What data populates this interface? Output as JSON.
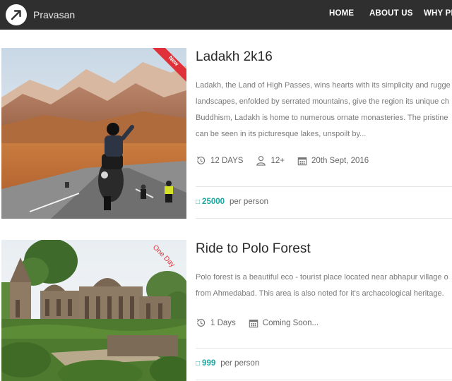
{
  "brand": {
    "name": "Pravasan"
  },
  "nav": {
    "items": [
      "HOME",
      "ABOUT US",
      "WHY PR"
    ]
  },
  "colors": {
    "navbar": "#2f2f2f",
    "accent": "#1aa7a1",
    "ribbon": "#e0303a"
  },
  "cards": [
    {
      "title": "Ladakh 2k16",
      "ribbon": "New",
      "description": [
        "Ladakh, the Land of High Passes, wins hearts with its simplicity and rugge",
        "landscapes, enfolded by serrated mountains, give the region its unique ch",
        "Buddhism, Ladakh is home to numerous ornate monasteries. The pristine",
        "can be seen in its picturesque lakes, unspoilt by..."
      ],
      "duration": "12 DAYS",
      "age": "12+",
      "date": "20th Sept, 2016",
      "currency_icon": "rupee-icon",
      "price": "25000",
      "per": "per person"
    },
    {
      "title": "Ride to Polo Forest",
      "ribbon": "One Day",
      "description": [
        "Polo forest is a beautiful eco - tourist place located near abhapur village o",
        "from Ahmedabad. This area is also noted for it's archacological heritage."
      ],
      "duration": "1 Days",
      "date": "Coming Soon...",
      "currency_icon": "rupee-icon",
      "price": "999",
      "per": "per person"
    }
  ]
}
